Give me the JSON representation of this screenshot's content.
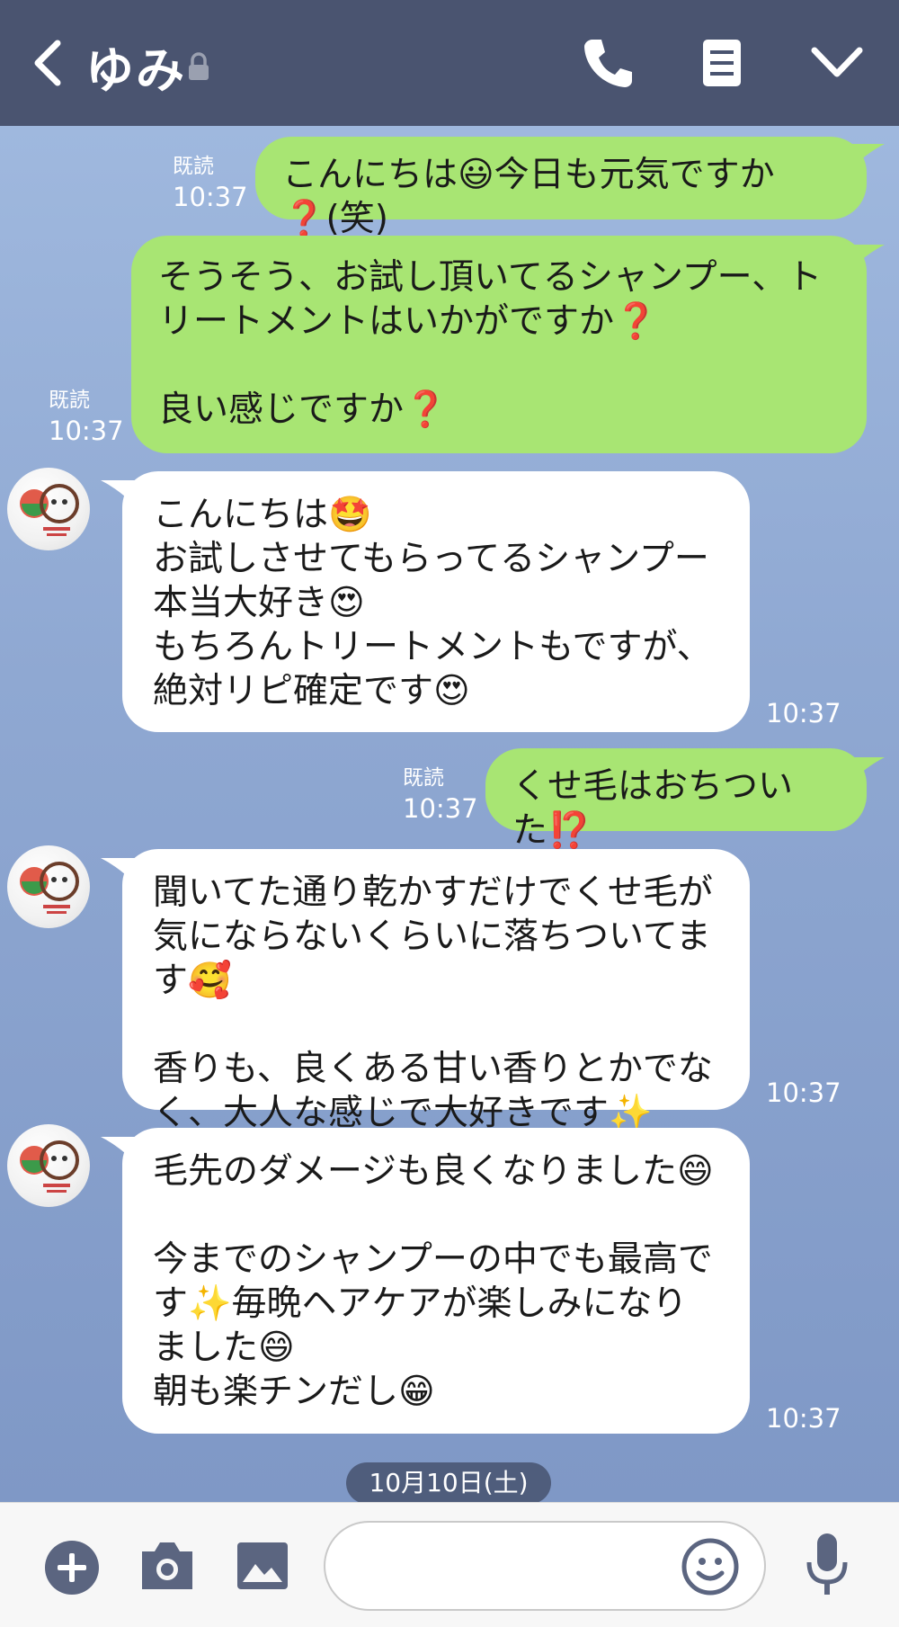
{
  "header": {
    "title": "ゆみ",
    "icons": [
      "back-arrow-icon",
      "lock-icon",
      "phone-icon",
      "menu-icon",
      "chevron-down-icon"
    ]
  },
  "messages": [
    {
      "dir": "out",
      "text": "こんにちは😃今日も元気ですか❓(笑)",
      "read": "既読",
      "time": "10:37"
    },
    {
      "dir": "out",
      "text": "そうそう、お試し頂いてるシャンプー、トリートメントはいかがですか❓\n\n良い感じですか❓",
      "read": "既読",
      "time": "10:37"
    },
    {
      "dir": "in",
      "text": "こんにちは🤩\nお試しさせてもらってるシャンプー本当大好き😍\nもちろんトリートメントもですが、絶対リピ確定です😍",
      "time": "10:37"
    },
    {
      "dir": "out",
      "text": "くせ毛はおちついた⁉️",
      "read": "既読",
      "time": "10:37"
    },
    {
      "dir": "in",
      "text": "聞いてた通り乾かすだけでくせ毛が気にならないくらいに落ちついてます🥰\n\n香りも、良くある甘い香りとかでなく、大人な感じで大好きです✨",
      "time": "10:37"
    },
    {
      "dir": "in",
      "text": "毛先のダメージも良くなりました😄\n\n今までのシャンプーの中でも最高です✨毎晩ヘアケアが楽しみになりました😄\n朝も楽チンだし😁",
      "time": "10:37"
    }
  ],
  "date_label": "10月10日(土)",
  "footer": {
    "icons": [
      "plus-icon",
      "camera-icon",
      "image-icon",
      "emoji-icon",
      "microphone-icon"
    ]
  },
  "colors": {
    "header": "#4a5470",
    "outgoing": "#a8e573",
    "incoming": "#ffffff",
    "background": "#8aa3cc"
  }
}
